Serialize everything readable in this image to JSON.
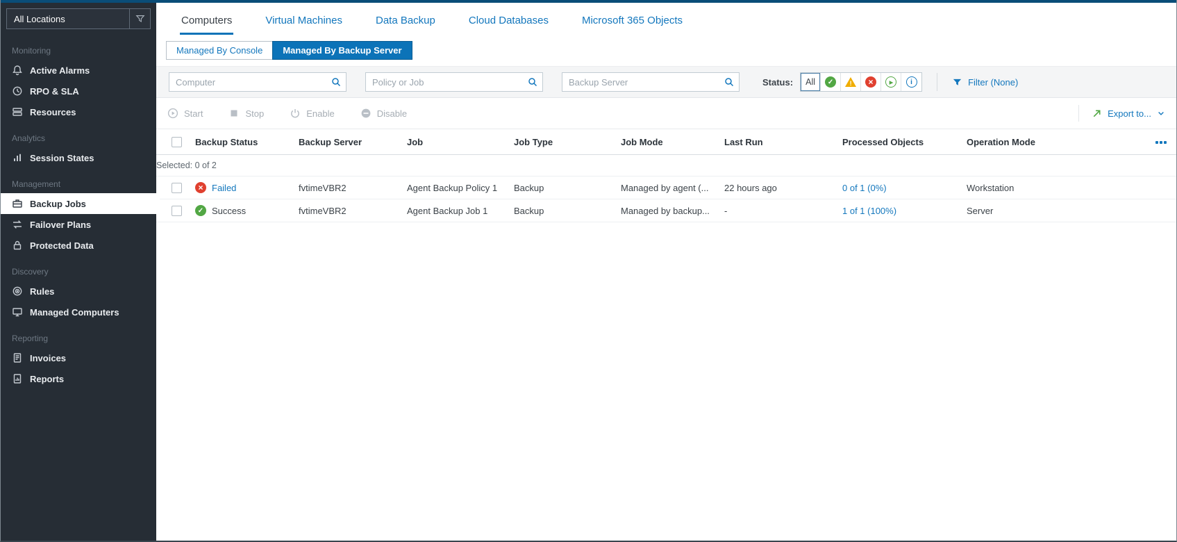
{
  "window": {
    "accent": "#0c73b8",
    "top_bar_color": "#0a4d78"
  },
  "sidebar": {
    "location_selector": {
      "value": "All Locations"
    },
    "sections": [
      {
        "label": "Monitoring",
        "items": [
          {
            "label": "Active Alarms",
            "icon": "bell-icon"
          },
          {
            "label": "RPO & SLA",
            "icon": "gauge-icon"
          },
          {
            "label": "Resources",
            "icon": "server-stack-icon"
          }
        ]
      },
      {
        "label": "Analytics",
        "items": [
          {
            "label": "Session States",
            "icon": "bar-chart-icon"
          }
        ]
      },
      {
        "label": "Management",
        "items": [
          {
            "label": "Backup Jobs",
            "icon": "briefcase-icon",
            "active": true
          },
          {
            "label": "Failover Plans",
            "icon": "failover-arrows-icon"
          },
          {
            "label": "Protected Data",
            "icon": "lock-icon"
          }
        ]
      },
      {
        "label": "Discovery",
        "items": [
          {
            "label": "Rules",
            "icon": "radar-icon"
          },
          {
            "label": "Managed Computers",
            "icon": "monitor-icon"
          }
        ]
      },
      {
        "label": "Reporting",
        "items": [
          {
            "label": "Invoices",
            "icon": "invoice-icon"
          },
          {
            "label": "Reports",
            "icon": "report-icon"
          }
        ]
      }
    ]
  },
  "tabs": [
    {
      "label": "Computers",
      "active": true
    },
    {
      "label": "Virtual Machines"
    },
    {
      "label": "Data Backup"
    },
    {
      "label": "Cloud Databases"
    },
    {
      "label": "Microsoft 365 Objects"
    }
  ],
  "subtabs": [
    {
      "label": "Managed By Console"
    },
    {
      "label": "Managed By Backup Server",
      "active": true
    }
  ],
  "filters": {
    "computer_placeholder": "Computer",
    "policy_placeholder": "Policy or Job",
    "server_placeholder": "Backup Server",
    "status_label": "Status:",
    "status_options": [
      {
        "label": "All",
        "name": "all",
        "selected": true
      },
      {
        "name": "success"
      },
      {
        "name": "warning"
      },
      {
        "name": "failed"
      },
      {
        "name": "running"
      },
      {
        "name": "info"
      }
    ],
    "filter_label": "Filter (None)"
  },
  "toolbar": {
    "start_label": "Start",
    "stop_label": "Stop",
    "enable_label": "Enable",
    "disable_label": "Disable",
    "export_label": "Export to..."
  },
  "table": {
    "columns": [
      "Backup Status",
      "Backup Server",
      "Job",
      "Job Type",
      "Job Mode",
      "Last Run",
      "Processed Objects",
      "Operation Mode"
    ],
    "selected_summary": "Selected: 0 of 2",
    "rows": [
      {
        "status": "Failed",
        "status_kind": "failed",
        "server": "fvtimeVBR2",
        "job": "Agent Backup Policy 1",
        "job_type": "Backup",
        "job_mode": "Managed by agent (...",
        "last_run": "22 hours ago",
        "processed": "0 of 1 (0%)",
        "operation_mode": "Workstation"
      },
      {
        "status": "Success",
        "status_kind": "success",
        "server": "fvtimeVBR2",
        "job": "Agent Backup Job 1",
        "job_type": "Backup",
        "job_mode": "Managed by backup...",
        "last_run": "-",
        "processed": "1 of 1 (100%)",
        "operation_mode": "Server"
      }
    ]
  }
}
